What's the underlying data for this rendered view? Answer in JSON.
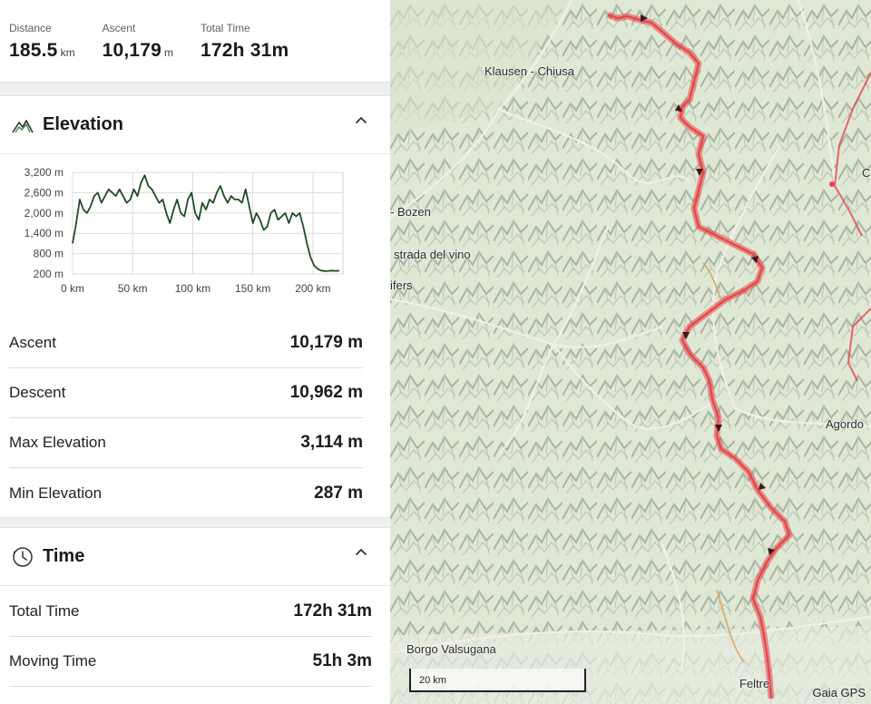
{
  "summary": {
    "distance_label": "Distance",
    "distance_value": "185.5",
    "distance_unit": "km",
    "ascent_label": "Ascent",
    "ascent_value": "10,179",
    "ascent_unit": "m",
    "time_label": "Total Time",
    "time_value": "172h 31m"
  },
  "elevation": {
    "title": "Elevation",
    "icon": "mountain-icon",
    "stats": [
      {
        "label": "Ascent",
        "value": "10,179 m"
      },
      {
        "label": "Descent",
        "value": "10,962 m"
      },
      {
        "label": "Max Elevation",
        "value": "3,114 m"
      },
      {
        "label": "Min Elevation",
        "value": "287 m"
      }
    ]
  },
  "time": {
    "title": "Time",
    "icon": "clock-icon",
    "stats": [
      {
        "label": "Total Time",
        "value": "172h 31m"
      },
      {
        "label": "Moving Time",
        "value": "51h 3m"
      }
    ]
  },
  "chart_data": {
    "type": "line",
    "title": "",
    "xlabel": "",
    "ylabel": "",
    "xlim": [
      0,
      225
    ],
    "ylim": [
      200,
      3200
    ],
    "x_ticks": [
      "0 km",
      "50 km",
      "100 km",
      "150 km",
      "200 km"
    ],
    "y_ticks": [
      "200 m",
      "800 m",
      "1,400 m",
      "2,000 m",
      "2,600 m",
      "3,200 m"
    ],
    "grid": true,
    "color": "#1f4d22",
    "series": [
      {
        "x": [
          0,
          3,
          6,
          9,
          12,
          15,
          18,
          21,
          24,
          27,
          30,
          33,
          36,
          39,
          42,
          45,
          48,
          51,
          54,
          57,
          60,
          63,
          66,
          69,
          72,
          75,
          78,
          81,
          84,
          87,
          90,
          93,
          96,
          99,
          102,
          105,
          108,
          111,
          114,
          117,
          120,
          123,
          126,
          129,
          132,
          135,
          138,
          141,
          144,
          147,
          150,
          153,
          156,
          159,
          162,
          165,
          168,
          171,
          174,
          177,
          180,
          183,
          186,
          189,
          192,
          195,
          198,
          201,
          204,
          207,
          210,
          213,
          216,
          219,
          222
        ],
        "y": [
          1100,
          1700,
          2400,
          2100,
          2000,
          2200,
          2500,
          2600,
          2300,
          2500,
          2700,
          2600,
          2500,
          2700,
          2500,
          2300,
          2400,
          2700,
          2500,
          2900,
          3114,
          2800,
          2700,
          2500,
          2300,
          2400,
          2000,
          1700,
          2100,
          2400,
          2000,
          1900,
          2400,
          2600,
          2000,
          1800,
          2300,
          2100,
          2400,
          2300,
          2600,
          2800,
          2500,
          2300,
          2500,
          2400,
          2400,
          2300,
          2700,
          2200,
          1700,
          2000,
          1800,
          1500,
          1600,
          2000,
          2100,
          1800,
          1900,
          2000,
          1700,
          2000,
          1900,
          2000,
          1600,
          1100,
          700,
          450,
          350,
          300,
          287,
          290,
          300,
          290,
          300
        ]
      }
    ]
  },
  "map": {
    "labels": [
      "Klausen - Chiusa",
      "Bozen",
      "strada del vino",
      "ifers",
      "Agordo",
      "Borgo Valsugana",
      "Feltre",
      "C"
    ],
    "scale_label": "20 km",
    "attribution": "Gaia GPS",
    "track_color": "#e8434a",
    "alt_route_color": "#d9a866",
    "road_color": "#f3efe6"
  }
}
